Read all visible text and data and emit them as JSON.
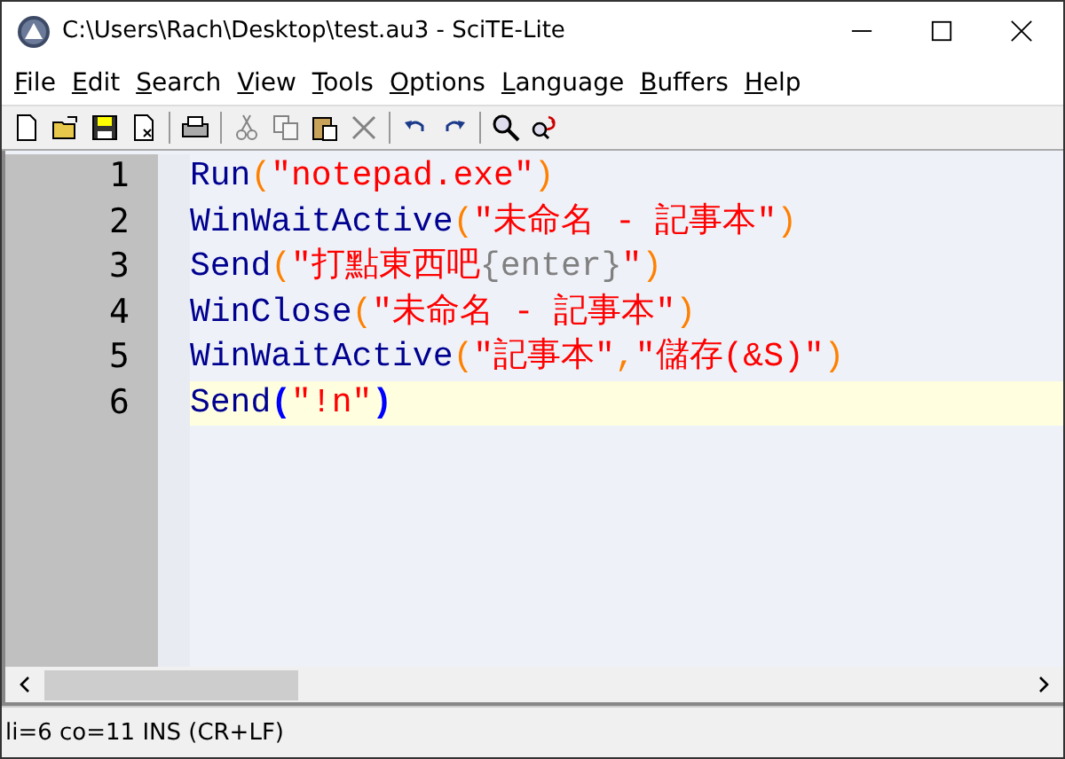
{
  "window": {
    "title": "C:\\Users\\Rach\\Desktop\\test.au3 - SciTE-Lite"
  },
  "menu": [
    "File",
    "Edit",
    "Search",
    "View",
    "Tools",
    "Options",
    "Language",
    "Buffers",
    "Help"
  ],
  "toolbar": [
    {
      "kind": "new",
      "disabled": false
    },
    {
      "kind": "open",
      "disabled": false
    },
    {
      "kind": "save",
      "disabled": false
    },
    {
      "kind": "close",
      "disabled": false
    },
    {
      "kind": "sep"
    },
    {
      "kind": "print",
      "disabled": false
    },
    {
      "kind": "sep"
    },
    {
      "kind": "cut",
      "disabled": true
    },
    {
      "kind": "copy",
      "disabled": true
    },
    {
      "kind": "paste",
      "disabled": false
    },
    {
      "kind": "delete",
      "disabled": true
    },
    {
      "kind": "sep"
    },
    {
      "kind": "undo",
      "disabled": false
    },
    {
      "kind": "redo",
      "disabled": false
    },
    {
      "kind": "sep"
    },
    {
      "kind": "find",
      "disabled": false
    },
    {
      "kind": "replace",
      "disabled": false
    }
  ],
  "editor": {
    "lines": [
      {
        "number": "1",
        "current": false,
        "tokens": [
          {
            "kind": "fn",
            "text": "Run"
          },
          {
            "kind": "op",
            "text": "("
          },
          {
            "kind": "str",
            "text": "\"notepad.exe\""
          },
          {
            "kind": "op",
            "text": ")"
          }
        ]
      },
      {
        "number": "2",
        "current": false,
        "tokens": [
          {
            "kind": "fn",
            "text": "WinWaitActive"
          },
          {
            "kind": "op",
            "text": "("
          },
          {
            "kind": "str",
            "text": "\"未命名 - 記事本\""
          },
          {
            "kind": "op",
            "text": ")"
          }
        ]
      },
      {
        "number": "3",
        "current": false,
        "tokens": [
          {
            "kind": "fn",
            "text": "Send"
          },
          {
            "kind": "op",
            "text": "("
          },
          {
            "kind": "str",
            "text": "\"打點東西吧"
          },
          {
            "kind": "key",
            "text": "{enter}"
          },
          {
            "kind": "str",
            "text": "\""
          },
          {
            "kind": "op",
            "text": ")"
          }
        ]
      },
      {
        "number": "4",
        "current": false,
        "tokens": [
          {
            "kind": "fn",
            "text": "WinClose"
          },
          {
            "kind": "op",
            "text": "("
          },
          {
            "kind": "str",
            "text": "\"未命名 - 記事本\""
          },
          {
            "kind": "op",
            "text": ")"
          }
        ]
      },
      {
        "number": "5",
        "current": false,
        "tokens": [
          {
            "kind": "fn",
            "text": "WinWaitActive"
          },
          {
            "kind": "op",
            "text": "("
          },
          {
            "kind": "str",
            "text": "\"記事本\""
          },
          {
            "kind": "op",
            "text": ","
          },
          {
            "kind": "str",
            "text": "\"儲存(&S)\""
          },
          {
            "kind": "op",
            "text": ")"
          }
        ]
      },
      {
        "number": "6",
        "current": true,
        "tokens": [
          {
            "kind": "fn",
            "text": "Send"
          },
          {
            "kind": "match",
            "text": "("
          },
          {
            "kind": "str",
            "text": "\"!n\""
          },
          {
            "kind": "match",
            "text": ")"
          }
        ]
      }
    ]
  },
  "status_bar": "li=6 co=11 INS (CR+LF)"
}
